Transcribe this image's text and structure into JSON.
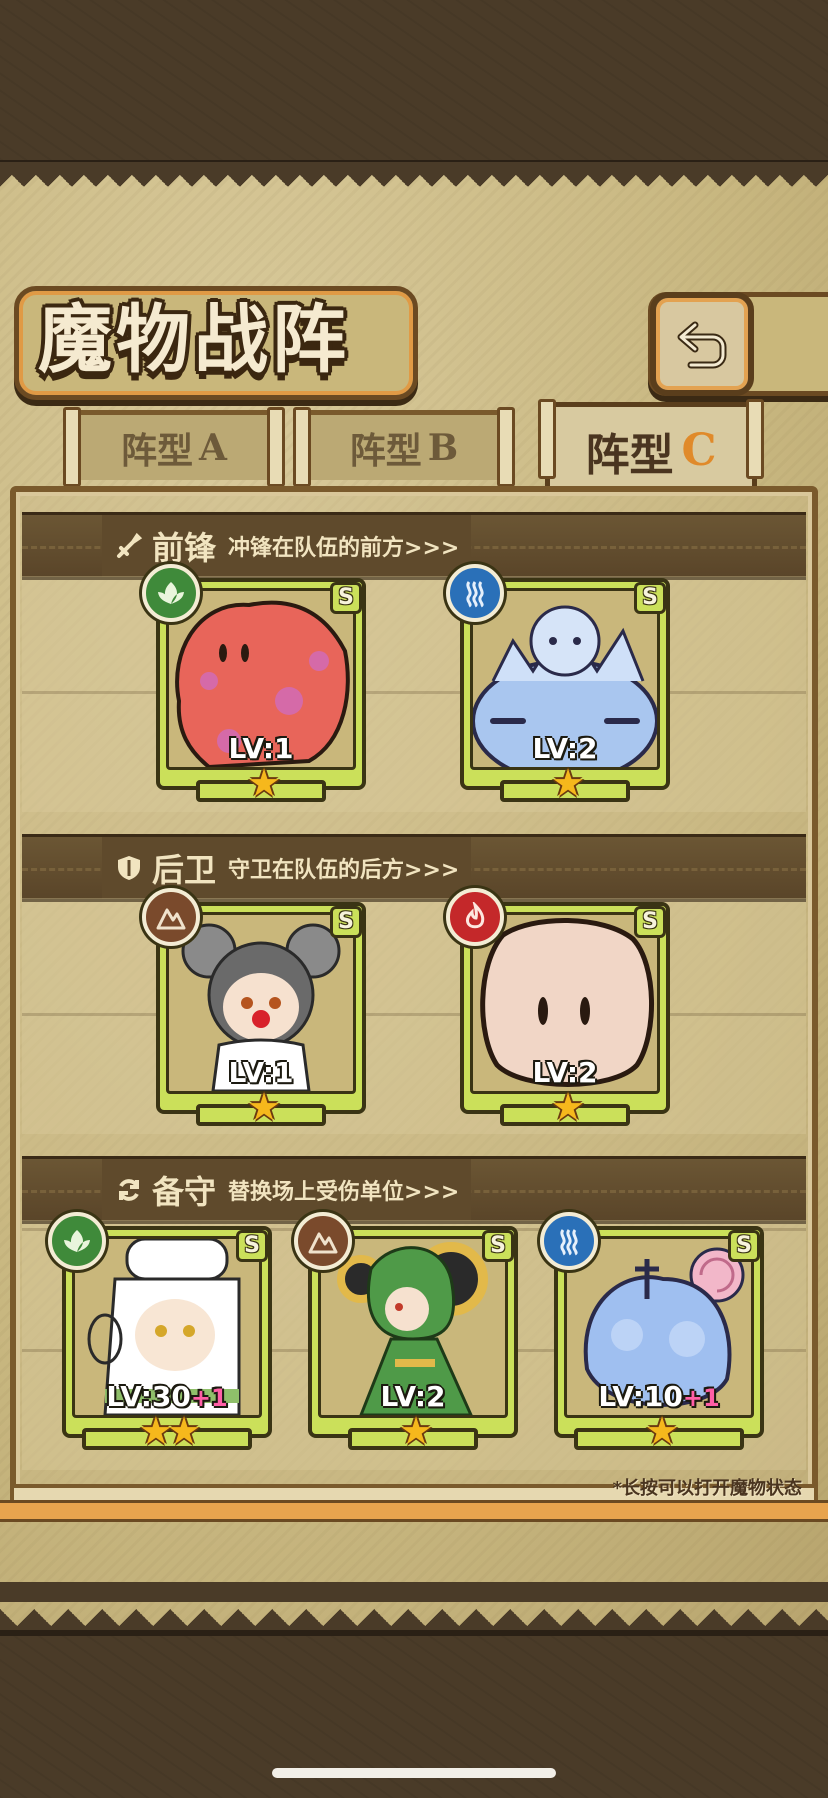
{
  "screen": {
    "title": "魔物战阵",
    "back_icon": "back-return-icon",
    "hint": "*长按可以打开魔物状态"
  },
  "tabs": [
    {
      "label": "阵型",
      "letter": "A",
      "active": false
    },
    {
      "label": "阵型",
      "letter": "B",
      "active": false
    },
    {
      "label": "阵型",
      "letter": "C",
      "active": true
    }
  ],
  "sections": {
    "vanguard": {
      "icon": "sword-icon",
      "title": "前锋",
      "desc": "冲锋在队伍的前方>>>"
    },
    "rearguard": {
      "icon": "shield-icon",
      "title": "后卫",
      "desc": "守卫在队伍的后方>>>"
    },
    "reserve": {
      "icon": "swap-cycle-icon",
      "title": "备守",
      "desc": "替换场上受伤单位>>>"
    }
  },
  "monsters": {
    "vanguard": [
      {
        "element": "grass-icon",
        "rank": "S",
        "level": "LV:1",
        "bonus": "",
        "stars": "★",
        "portrait": "red-blob-monster"
      },
      {
        "element": "water-icon",
        "rank": "S",
        "level": "LV:2",
        "bonus": "",
        "stars": "★",
        "portrait": "blue-slime-girl"
      }
    ],
    "rearguard": [
      {
        "element": "earth-icon",
        "rank": "S",
        "level": "LV:1",
        "bonus": "",
        "stars": "★",
        "portrait": "koala-girl"
      },
      {
        "element": "fire-icon",
        "rank": "S",
        "level": "LV:2",
        "bonus": "",
        "stars": "★",
        "portrait": "dough-ball-monster"
      }
    ],
    "reserve": [
      {
        "element": "grass-icon",
        "rank": "S",
        "level": "LV:30",
        "bonus": "+1",
        "stars": "★★",
        "portrait": "chef-girl"
      },
      {
        "element": "earth-icon",
        "rank": "S",
        "level": "LV:2",
        "bonus": "",
        "stars": "★",
        "portrait": "leaf-girl"
      },
      {
        "element": "water-icon",
        "rank": "S",
        "level": "LV:10",
        "bonus": "+1",
        "stars": "★",
        "portrait": "jellyfish-monster"
      }
    ]
  },
  "colors": {
    "card_frame": "#cbe05a",
    "grass": "#3f8a3a",
    "water": "#2a70b8",
    "earth": "#7a4a2c",
    "fire": "#c4282a",
    "star": "#f6b81c",
    "bonus": "#ff5fa6"
  }
}
